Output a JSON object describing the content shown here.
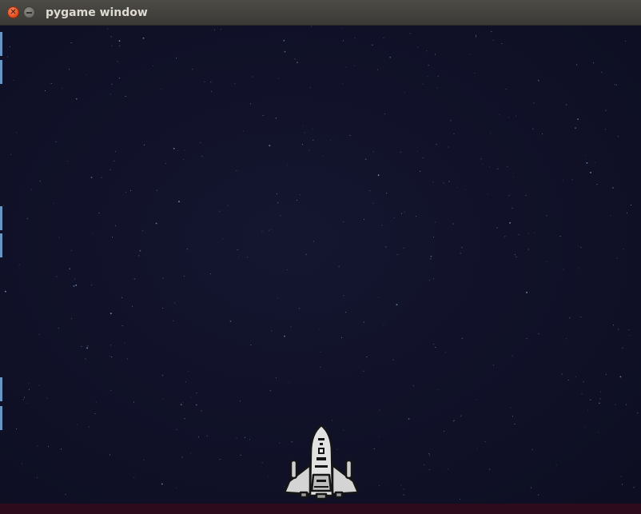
{
  "window": {
    "title": "pygame window",
    "buttons": [
      "close-icon",
      "minimize-icon"
    ]
  },
  "game": {
    "background": "starfield",
    "colors": {
      "sky": "#111229",
      "frame": "#2a0d1e",
      "star": "#8fb4e8",
      "ship_body": "#d9d9d9",
      "ship_outline": "#1a1a1a"
    },
    "sprites": [
      "spaceship-player"
    ]
  }
}
